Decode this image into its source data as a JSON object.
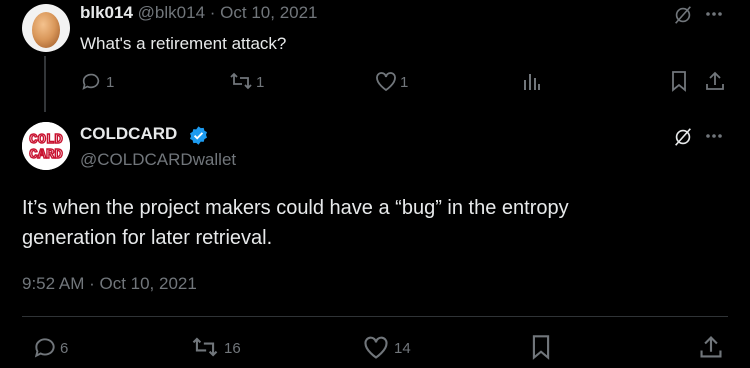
{
  "parent": {
    "name": "blk014",
    "handle": "@blk014",
    "separator": "·",
    "date": "Oct 10, 2021",
    "text": "What's a retirement attack?",
    "actions": {
      "reply_count": "1",
      "retweet_count": "1",
      "like_count": "1"
    }
  },
  "reply": {
    "name": "COLDCARD",
    "handle": "@COLDCARDwallet",
    "avatar_text_top": "COLD",
    "avatar_text_bottom": "CARD",
    "text": "It’s when the project makers could have a “bug” in the entropy generation for later retrieval.",
    "timestamp": "9:52 AM · Oct 10, 2021",
    "actions": {
      "reply_count": "6",
      "retweet_count": "16",
      "like_count": "14"
    }
  },
  "icons": {
    "grok": "grok-slash-icon",
    "more": "more-dots-icon",
    "reply": "reply-bubble-icon",
    "retweet": "retweet-arrows-icon",
    "like": "heart-icon",
    "views": "bar-chart-icon",
    "bookmark": "bookmark-icon",
    "share": "share-upload-icon",
    "verified": "verified-badge-icon"
  },
  "colors": {
    "background": "#000000",
    "text": "#e7e9ea",
    "muted": "#71767b",
    "verified": "#1d9bf0",
    "brand_red": "#c8102e"
  }
}
